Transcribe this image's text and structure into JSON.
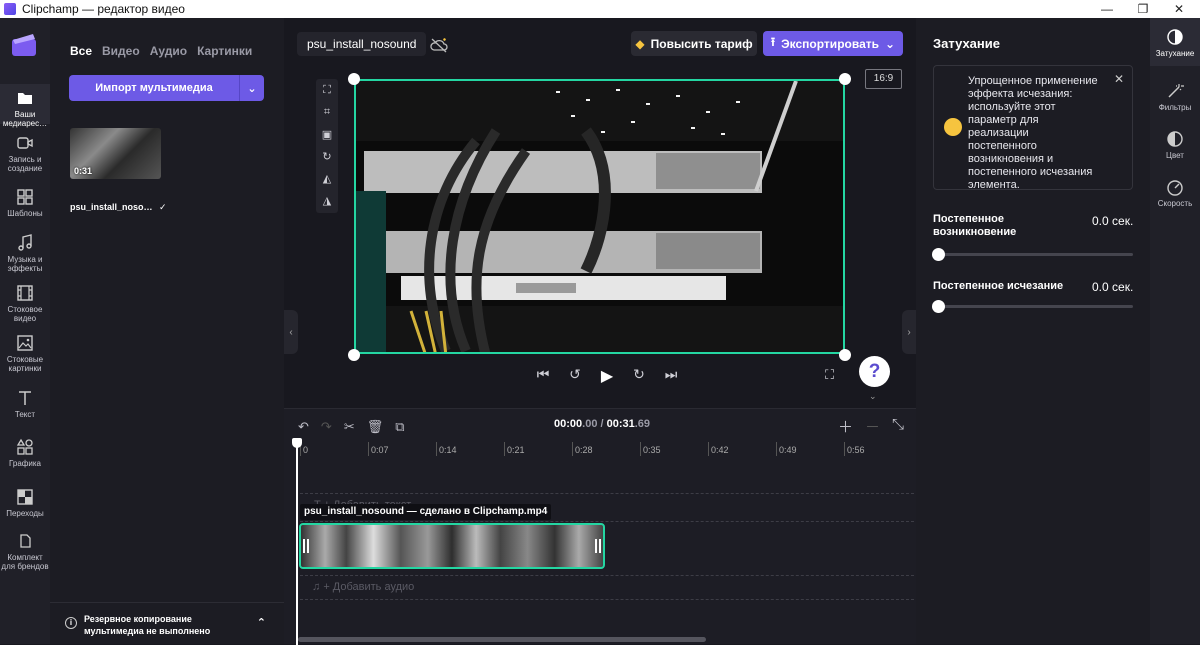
{
  "window": {
    "title": "Clipchamp — редактор видео"
  },
  "left_rail": {
    "items": [
      {
        "label": "Ваши медиарес…",
        "icon": "folder-icon"
      },
      {
        "label": "Запись и создание",
        "icon": "camera-icon"
      },
      {
        "label": "Шаблоны",
        "icon": "templates-icon"
      },
      {
        "label": "Музыка и эффекты",
        "icon": "music-icon"
      },
      {
        "label": "Стоковое видео",
        "icon": "film-icon"
      },
      {
        "label": "Стоковые картинки",
        "icon": "image-icon"
      },
      {
        "label": "Текст",
        "icon": "text-icon"
      },
      {
        "label": "Графика",
        "icon": "shapes-icon"
      },
      {
        "label": "Переходы",
        "icon": "transitions-icon"
      },
      {
        "label": "Комплект для брендов",
        "icon": "brand-kit-icon"
      }
    ]
  },
  "media": {
    "tabs": [
      "Все",
      "Видео",
      "Аудио",
      "Картинки"
    ],
    "import_label": "Импорт мультимедиа",
    "item": {
      "duration": "0:31",
      "name": "psu_install_noso…"
    },
    "backup_text": "Резервное копирование мультимедиа не выполнено"
  },
  "header": {
    "project_name": "psu_install_nosound",
    "upgrade_label": "Повысить тариф",
    "export_label": "Экспортировать",
    "aspect": "16:9"
  },
  "timeline": {
    "time_current": "00:00",
    "time_current_ms": ".00",
    "time_separator": " / ",
    "time_total": "00:31",
    "time_total_ms": ".69",
    "ticks": [
      "0",
      "0:07",
      "0:14",
      "0:21",
      "0:28",
      "0:35",
      "0:42",
      "0:49",
      "0:56"
    ],
    "text_track_placeholder": "T  + Добавить текст",
    "clip_label": "psu_install_nosound — сделано в Clipchamp.mp4",
    "audio_track_placeholder": "+ Добавить аудио"
  },
  "props": {
    "title": "Затухание",
    "tip": "Упрощенное применение эффекта исчезания: используйте этот параметр для реализации постепенного возникновения и постепенного исчезания элемента.",
    "fade_in_label": "Постепенное возникновение",
    "fade_in_value": "0.0 сек.",
    "fade_out_label": "Постепенное исчезание",
    "fade_out_value": "0.0 сек."
  },
  "right_rail": {
    "items": [
      {
        "label": "Затухание",
        "icon": "fade-icon"
      },
      {
        "label": "Фильтры",
        "icon": "filters-icon"
      },
      {
        "label": "Цвет",
        "icon": "color-icon"
      },
      {
        "label": "Скорость",
        "icon": "speed-icon"
      }
    ]
  }
}
